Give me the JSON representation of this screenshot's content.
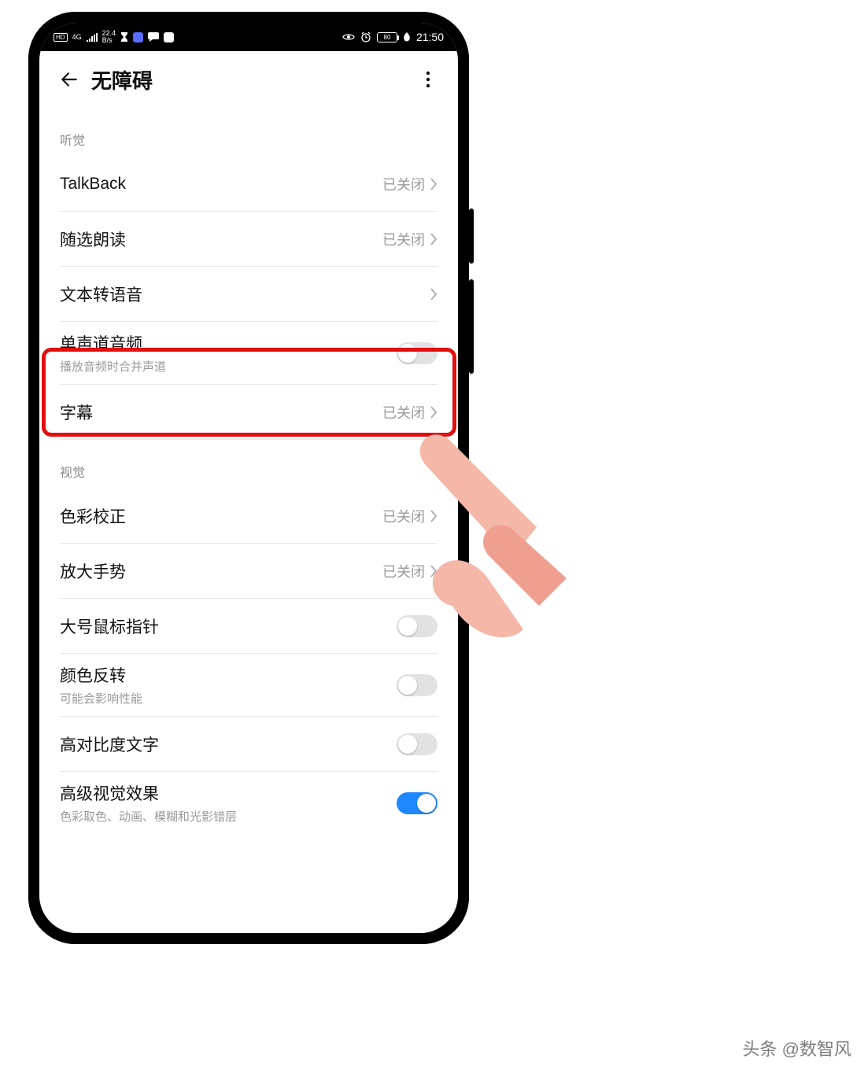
{
  "statusbar": {
    "hd": "HD",
    "net": "4G",
    "speed_top": "22.4",
    "speed_bottom": "B/s",
    "time": "21:50",
    "battery": "80"
  },
  "header": {
    "title": "无障碍"
  },
  "sections": {
    "hearing": "听觉",
    "visual": "视觉"
  },
  "rows": {
    "talkback": {
      "label": "TalkBack",
      "status": "已关闭"
    },
    "readaloud": {
      "label": "随选朗读",
      "status": "已关闭"
    },
    "tts": {
      "label": "文本转语音"
    },
    "mono": {
      "label": "单声道音频",
      "sub": "播放音频时合并声道"
    },
    "subtitle": {
      "label": "字幕",
      "status": "已关闭"
    },
    "colorcorr": {
      "label": "色彩校正",
      "status": "已关闭"
    },
    "magnify": {
      "label": "放大手势",
      "status": "已关闭"
    },
    "bigcursor": {
      "label": "大号鼠标指针"
    },
    "invert": {
      "label": "颜色反转",
      "sub": "可能会影响性能"
    },
    "contrast": {
      "label": "高对比度文字"
    },
    "advvisual": {
      "label": "高级视觉效果",
      "sub": "色彩取色、动画、模糊和光影错层"
    }
  },
  "watermark": "头条 @数智风"
}
